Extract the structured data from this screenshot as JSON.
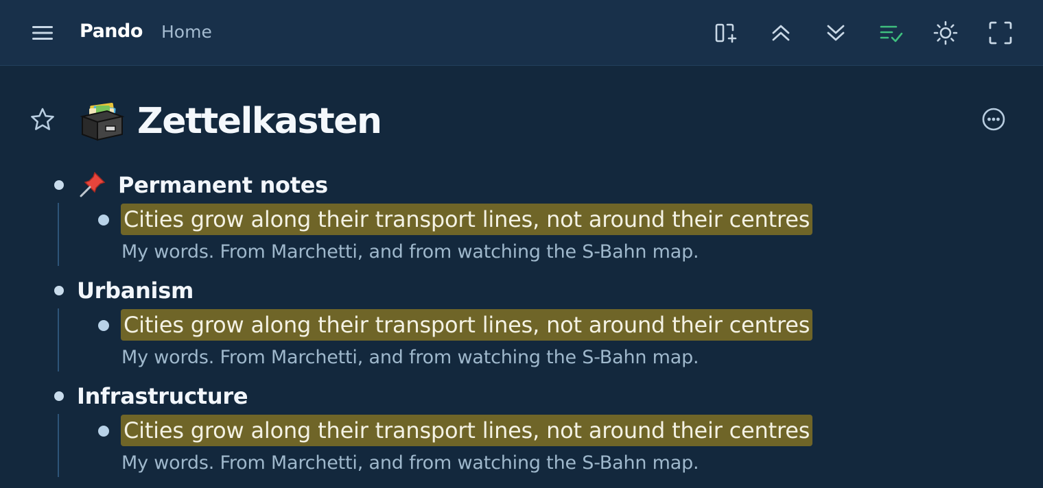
{
  "header": {
    "brand": "Pando",
    "breadcrumb": "Home",
    "icons": [
      "menu-icon",
      "add-panel-icon",
      "collapse-all-icon",
      "expand-all-icon",
      "checklist-icon",
      "sun-icon",
      "fullscreen-icon"
    ],
    "accent": "#3fbf7f"
  },
  "page": {
    "title": "Zettelkasten",
    "title_icon": "card-file-box-icon"
  },
  "outline": [
    {
      "label": "Permanent notes",
      "icon": "pushpin-icon",
      "children": [
        {
          "text": "Cities grow along their transport lines, not around their centres",
          "note": "My words. From Marchetti, and from watching the S-Bahn map."
        }
      ]
    },
    {
      "label": "Urbanism",
      "children": [
        {
          "text": "Cities grow along their transport lines, not around their centres",
          "note": "My words. From Marchetti, and from watching the S-Bahn map."
        }
      ]
    },
    {
      "label": "Infrastructure",
      "children": [
        {
          "text": "Cities grow along their transport lines, not around their centres",
          "note": "My words. From Marchetti, and from watching the S-Bahn map."
        }
      ]
    }
  ],
  "colors": {
    "background": "#13283d",
    "topbar": "#18304a",
    "highlight": "#6f6528"
  }
}
